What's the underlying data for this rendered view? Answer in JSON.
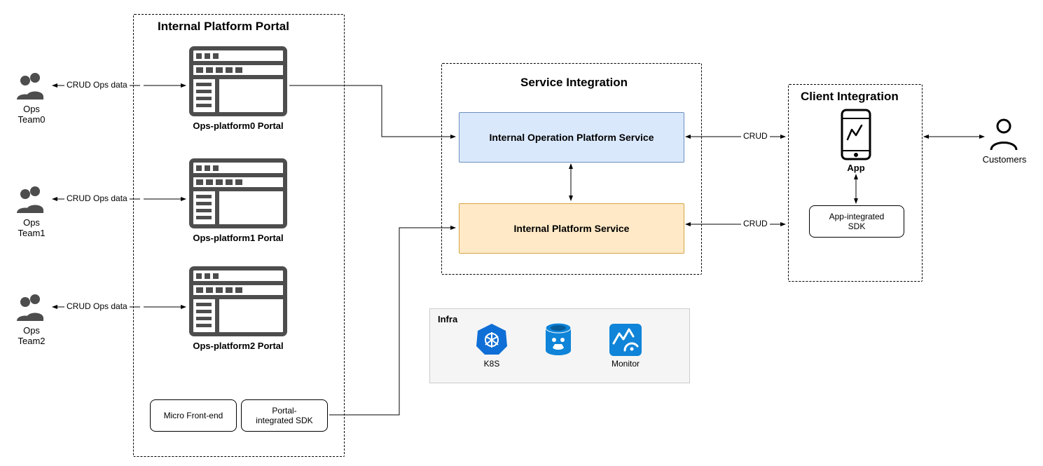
{
  "portal": {
    "title": "Internal Platform Portal",
    "teams": [
      {
        "name": "Ops Team0",
        "edge": "CRUD Ops data",
        "portal": "Ops-platform0 Portal"
      },
      {
        "name": "Ops Team1",
        "edge": "CRUD Ops data",
        "portal": "Ops-platform1 Portal"
      },
      {
        "name": "Ops Team2",
        "edge": "CRUD Ops data",
        "portal": "Ops-platform2 Portal"
      }
    ],
    "micro_front_end": "Micro Front-end",
    "portal_sdk_l1": "Portal-",
    "portal_sdk_l2": "integrated SDK"
  },
  "service": {
    "title": "Service Integration",
    "op_service": "Internal Operation Platform Service",
    "platform_service": "Internal Platform Service",
    "crud1": "CRUD",
    "crud2": "CRUD"
  },
  "infra": {
    "title": "Infra",
    "k8s": "K8S",
    "db": "",
    "monitor": "Monitor"
  },
  "client": {
    "title": "Client Integration",
    "app": "App",
    "sdk_l1": "App-integrated",
    "sdk_l2": "SDK",
    "customers": "Customers"
  }
}
